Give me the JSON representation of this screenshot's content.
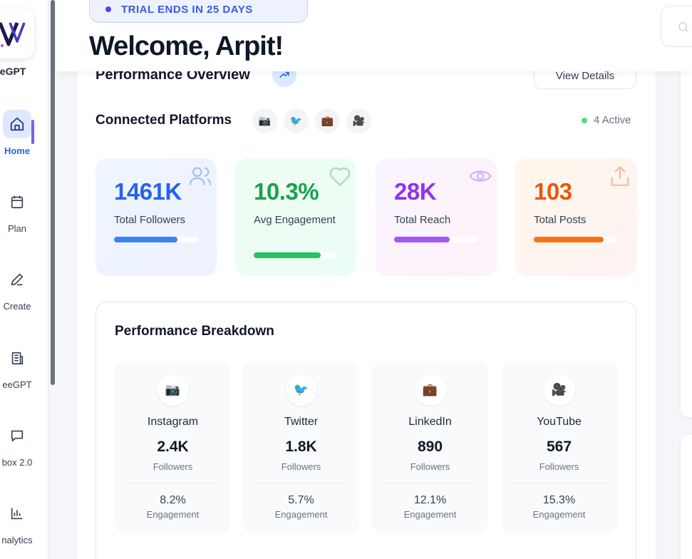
{
  "sidebar": {
    "brand": "eeGPT",
    "items": [
      {
        "label": "Home",
        "icon": "home-icon",
        "active": true
      },
      {
        "label": "Plan",
        "icon": "calendar-icon"
      },
      {
        "label": "Create",
        "icon": "pen-icon"
      },
      {
        "label": "eeGPT",
        "icon": "building-icon"
      },
      {
        "label": "box 2.0",
        "icon": "message-icon"
      },
      {
        "label": "nalytics",
        "icon": "bar-chart-icon"
      }
    ]
  },
  "header": {
    "trial": "TRIAL ENDS IN 25 DAYS",
    "welcome": "Welcome, Arpit!"
  },
  "overview": {
    "title": "Performance Overview",
    "view_details": "View Details",
    "connected_title": "Connected Platforms",
    "active_count": "4 Active"
  },
  "platform_icons": [
    "📷",
    "🐦",
    "💼",
    "🎥"
  ],
  "stats": [
    {
      "value": "1461K",
      "label": "Total Followers",
      "color": "#2563eb",
      "bar_color": "#3b82f6",
      "progress": 0.75,
      "icon": "users-icon"
    },
    {
      "value": "10.3%",
      "label": "Avg Engagement",
      "color": "#16a34a",
      "bar_color": "#22c55e",
      "progress": 0.8,
      "icon": "heart-icon"
    },
    {
      "value": "28K",
      "label": "Total Reach",
      "color": "#9333ea",
      "bar_color": "#a855f7",
      "progress": 0.66,
      "icon": "eye-icon"
    },
    {
      "value": "103",
      "label": "Total Posts",
      "color": "#ea580c",
      "bar_color": "#f97316",
      "progress": 0.83,
      "icon": "share-icon"
    }
  ],
  "breakdown": {
    "title": "Performance Breakdown",
    "platforms": [
      {
        "name": "Instagram",
        "icon": "📷",
        "followers": "2.4K",
        "followers_label": "Followers",
        "engagement": "8.2%",
        "engagement_label": "Engagement"
      },
      {
        "name": "Twitter",
        "icon": "🐦",
        "followers": "1.8K",
        "followers_label": "Followers",
        "engagement": "5.7%",
        "engagement_label": "Engagement"
      },
      {
        "name": "LinkedIn",
        "icon": "💼",
        "followers": "890",
        "followers_label": "Followers",
        "engagement": "12.1%",
        "engagement_label": "Engagement"
      },
      {
        "name": "YouTube",
        "icon": "🎥",
        "followers": "567",
        "followers_label": "Followers",
        "engagement": "15.3%",
        "engagement_label": "Engagement"
      }
    ]
  }
}
